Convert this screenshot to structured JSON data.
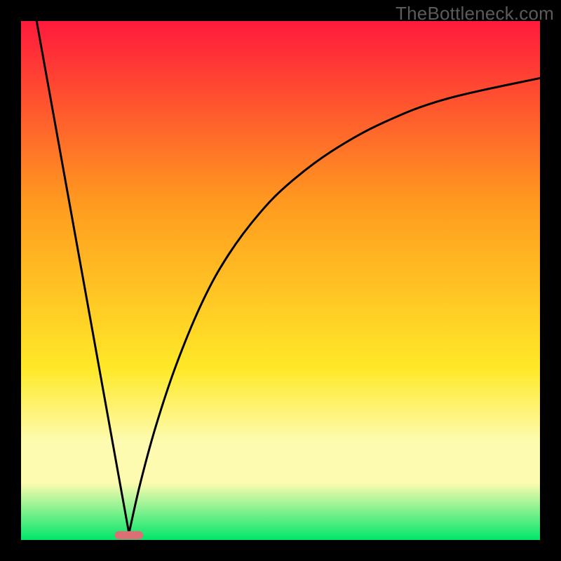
{
  "watermark": "TheBottleneck.com",
  "chart_data": {
    "type": "line",
    "title": "",
    "xlabel": "",
    "ylabel": "",
    "xlim": [
      0,
      100
    ],
    "ylim": [
      0,
      100
    ],
    "grid": false,
    "legend": false,
    "background_gradient": {
      "top_color": "#ff1a3c",
      "mid_upper_color": "#ff9a1f",
      "mid_lower_color": "#ffe928",
      "pale_band_color": "#fdfbb0",
      "bottom_color": "#00e66a"
    },
    "marker": {
      "shape": "rounded-bar",
      "color": "#db6f74",
      "x_center": 20.8,
      "y": 0.9,
      "width": 5.5,
      "height": 1.6
    },
    "series": [
      {
        "name": "left-branch",
        "description": "steep line from top-left edge down to marker minimum",
        "x": [
          3.0,
          20.8
        ],
        "y": [
          100.0,
          1.3
        ]
      },
      {
        "name": "right-branch",
        "description": "curve rising from marker minimum with slope decreasing, approaching top-right",
        "x": [
          20.8,
          23,
          26,
          30,
          35,
          40,
          46,
          52,
          60,
          70,
          82,
          100
        ],
        "y": [
          1.3,
          11,
          22,
          34,
          46,
          55,
          63,
          69,
          75,
          80.5,
          85,
          89
        ]
      }
    ]
  }
}
